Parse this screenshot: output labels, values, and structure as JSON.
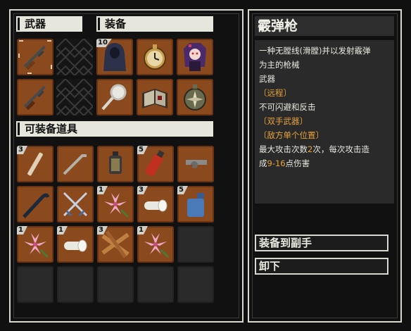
{
  "sections": {
    "weapons": "武器",
    "equipment": "装备",
    "equippable_items": "可装备道具"
  },
  "weapon_slots": [
    {
      "icon": "shotgun-icon",
      "selected": true
    },
    {
      "icon": "locked-slot-icon"
    },
    {
      "icon": "shotgun-icon"
    },
    {
      "icon": "locked-slot-icon"
    }
  ],
  "equipment_slots": [
    {
      "icon": "hooded-cloak-icon",
      "count": "10"
    },
    {
      "icon": "pocket-watch-icon"
    },
    {
      "icon": "purple-haired-doll-icon"
    },
    {
      "icon": "magnifying-glass-icon"
    },
    {
      "icon": "spell-book-icon"
    },
    {
      "icon": "compass-amulet-icon"
    }
  ],
  "inventory": [
    {
      "icon": "chalk-stick-icon",
      "count": "3"
    },
    {
      "icon": "crowbar-icon"
    },
    {
      "icon": "lantern-icon"
    },
    {
      "icon": "fire-extinguisher-icon",
      "count": "5"
    },
    {
      "icon": "revolver-icon"
    },
    {
      "icon": "walking-cane-icon"
    },
    {
      "icon": "crossed-swords-icon"
    },
    {
      "icon": "pink-lily-icon",
      "count": "1"
    },
    {
      "icon": "bandage-roll-icon",
      "count": "3"
    },
    {
      "icon": "water-jug-icon",
      "count": "5"
    },
    {
      "icon": "pink-lily-icon",
      "count": "1"
    },
    {
      "icon": "bandage-roll-icon",
      "count": "1"
    },
    {
      "icon": "wooden-planks-icon",
      "count": "3"
    },
    {
      "icon": "pink-lily-icon",
      "count": "1"
    },
    {
      "icon": "empty"
    },
    {
      "icon": "empty"
    },
    {
      "icon": "empty"
    },
    {
      "icon": "empty"
    },
    {
      "icon": "empty"
    },
    {
      "icon": "empty"
    }
  ],
  "details": {
    "name": "霰弹枪",
    "desc_line1": "一种无膛线(滑膛)并以发射霰弹",
    "desc_line2": "为主的枪械",
    "type": "武器",
    "tag_ranged": "〔远程〕",
    "no_dodge": "不可闪避和反击",
    "tag_two_handed": "〔双手武器〕",
    "tag_single_target": "〔敌方单个位置〕",
    "attack_prefix": "最大攻击次数",
    "attack_count": "2",
    "attack_mid": "次，每次攻击造",
    "damage_prefix": "成",
    "damage_range": "9-16",
    "damage_suffix": "点伤害"
  },
  "buttons": {
    "equip_offhand": "装备到副手",
    "unequip": "卸下"
  },
  "colors": {
    "slot_item": "#8a4a1e",
    "slot_empty": "#2a2a2a",
    "highlight": "#e8a23a",
    "header_bg": "#e6e6dc"
  }
}
